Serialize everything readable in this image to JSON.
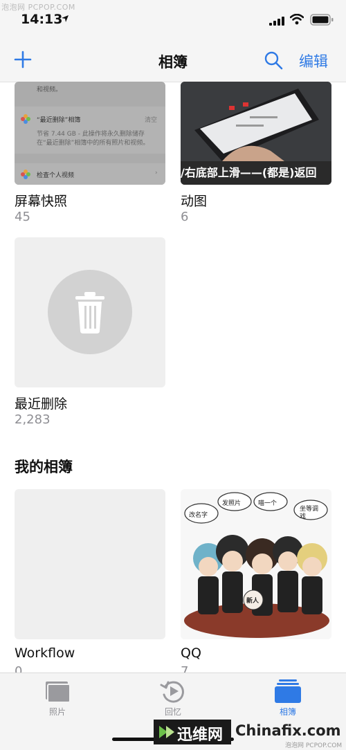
{
  "watermark_top": "泡泡网 PCPOP.COM",
  "status": {
    "time": "14:13"
  },
  "nav": {
    "title": "相簿",
    "edit": "编辑"
  },
  "albums": [
    {
      "label": "屏幕快照",
      "count": "45"
    },
    {
      "label": "动图",
      "count": "6"
    },
    {
      "label": "最近删除",
      "count": "2,283"
    }
  ],
  "section": {
    "my_albums": "我的相簿"
  },
  "my_albums": [
    {
      "label": "Workflow",
      "count": "0"
    },
    {
      "label": "QQ",
      "count": "7"
    }
  ],
  "shot_thumb": {
    "line1": "和视频。",
    "row1_title": "“最近删除”相簿",
    "row1_action": "清空",
    "row1_desc": "节省 7.44 GB - 此操作将永久删除储存在“最近删除”相簿中的所有照片和视频。",
    "row2_title": "检查个人视频"
  },
  "gif_thumb": {
    "caption": "/右底部上滑——(都是)返回"
  },
  "qq_thumb": {
    "bubbles": [
      "改名字",
      "发照片",
      "喵一个",
      "坐等调戏"
    ],
    "badge": "新人"
  },
  "tabs": [
    {
      "label": "照片",
      "icon": "photos-tab-icon"
    },
    {
      "label": "回忆",
      "icon": "memories-tab-icon"
    },
    {
      "label": "相簿",
      "icon": "albums-tab-icon",
      "active": true
    }
  ],
  "colors": {
    "accent": "#2f7ae5",
    "secondary_text": "#8e8e93",
    "tab_bg": "#f4f4f4"
  },
  "watermark": {
    "cn": "迅维网",
    "en": "Chinafix.com",
    "sub": "泡泡网 PCPOP.COM"
  }
}
